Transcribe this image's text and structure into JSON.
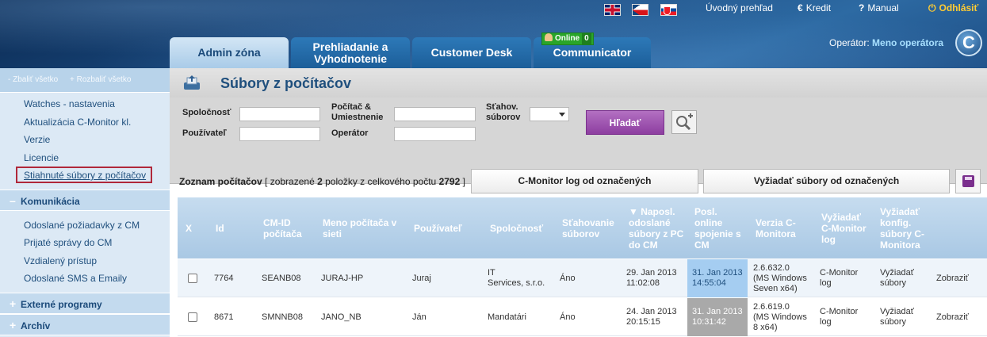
{
  "header": {
    "links": {
      "overview": "Úvodný prehľad",
      "credit": "Kredit",
      "manual": "Manual",
      "logout": "Odhlásiť"
    },
    "tabs": {
      "admin": "Admin zóna",
      "review_line1": "Prehliadanie a",
      "review_line2": "Vyhodnotenie",
      "desk": "Customer Desk",
      "comm": "Communicator"
    },
    "online_label": "Online",
    "online_count": "0",
    "operator_label": "Operátor:",
    "operator_name": "Meno operátora",
    "logo_letter": "C"
  },
  "sidebar": {
    "collapse_all": "- Zbaliť všetko",
    "expand_all": "+ Rozbaliť všetko",
    "items_admin": [
      "Watches - nastavenia",
      "Aktualizácia C-Monitor kl.",
      "Verzie",
      "Licencie",
      "Stiahnuté súbory z počítačov"
    ],
    "group_comm": "Komunikácia",
    "items_comm": [
      "Odoslané požiadavky z CM",
      "Prijaté správy do CM",
      "Vzdialený prístup",
      "Odoslané SMS a Emaily"
    ],
    "group_ext": "Externé programy",
    "group_archive": "Archív"
  },
  "page": {
    "title": "Súbory z počítačov",
    "filter": {
      "company": "Spoločnosť",
      "user": "Používateľ",
      "computer_line1": "Počítač &",
      "computer_line2": "Umiestnenie",
      "operator": "Operátor",
      "download_line1": "Sťahov.",
      "download_line2": "súborov",
      "search_button": "Hľadať"
    },
    "summary": {
      "label": "Zoznam počítačov",
      "pre": "[ zobrazené",
      "shown": "2",
      "mid": "položky z celkového počtu",
      "total": "2792",
      "post": "]"
    },
    "buttons": {
      "cm_log": "C-Monitor log od označených",
      "request_files": "Vyžiadať súbory od označených"
    }
  },
  "table": {
    "columns": {
      "x": "X",
      "id": "Id",
      "cmid_1": "CM-ID",
      "cmid_2": "počítača",
      "name_1": "Meno počítača v",
      "name_2": "sieti",
      "user": "Používateľ",
      "company": "Spoločnosť",
      "dl_1": "Sťahovanie",
      "dl_2": "súborov",
      "last_1": "▼ Naposl.",
      "last_2": "odoslané",
      "last_3": "súbory z PC",
      "last_4": "do CM",
      "online_1": "Posl.",
      "online_2": "online",
      "online_3": "spojenie s",
      "online_4": "CM",
      "ver_1": "Verzia C-",
      "ver_2": "Monitora",
      "req_log_1": "Vyžiadať",
      "req_log_2": "C-Monitor",
      "req_log_3": "log",
      "req_cfg_1": "Vyžiadať",
      "req_cfg_2": "konfig.",
      "req_cfg_3": "súbory C-",
      "req_cfg_4": "Monitora"
    },
    "rows": [
      {
        "id": "7764",
        "cmid": "SEANB08",
        "name": "JURAJ-HP",
        "user": "Juraj",
        "company_1": "IT",
        "company_2": "Services, s.r.o.",
        "download": "Áno",
        "last_1": "29. Jan 2013",
        "last_2": "11:02:08",
        "online_1": "31. Jan 2013",
        "online_2": "14:55:04",
        "ver_1": "2.6.632.0",
        "ver_2": "(MS Windows",
        "ver_3": "Seven x64)",
        "log_1": "C-Monitor",
        "log_2": "log",
        "cfg_1": "Vyžiadať",
        "cfg_2": "súbory",
        "show": "Zobraziť"
      },
      {
        "id": "8671",
        "cmid": "SMNNB08",
        "name": "JANO_NB",
        "user": "Ján",
        "company_1": "Mandatári",
        "company_2": "",
        "download": "Áno",
        "last_1": "24. Jan 2013",
        "last_2": "20:15:15",
        "online_1": "31. Jan 2013",
        "online_2": "10:31:42",
        "ver_1": "2.6.619.0",
        "ver_2": "(MS Windows",
        "ver_3": "8 x64)",
        "log_1": "C-Monitor",
        "log_2": "log",
        "cfg_1": "Vyžiadať",
        "cfg_2": "súbory",
        "show": "Zobraziť"
      }
    ]
  },
  "icons": {
    "credit": "euro-icon",
    "manual": "question-icon",
    "logout": "power-icon"
  }
}
